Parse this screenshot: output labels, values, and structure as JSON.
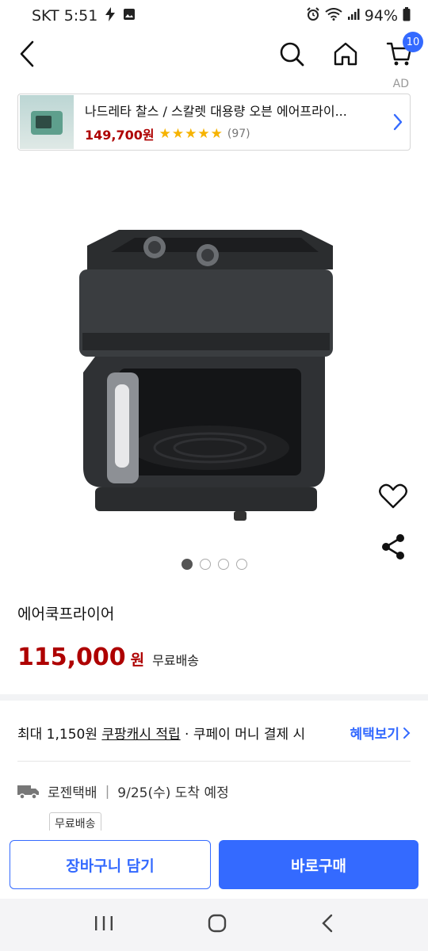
{
  "status": {
    "carrier_time": "SKT 5:51",
    "battery": "94%"
  },
  "nav": {
    "cart_count": "10"
  },
  "ad": {
    "label": "AD",
    "title": "나드레타 찰스 / 스칼렛 대용량 오븐 에어프라이...",
    "price": "149,700원",
    "review_count": "(97)",
    "rating_stars": 5
  },
  "product": {
    "name": "에어쿡프라이어",
    "price": "115,000",
    "price_unit": "원",
    "shipping": "무료배송",
    "image_count": 4,
    "active_image": 1
  },
  "benefit": {
    "text_prefix": "최대 1,150원 ",
    "text_underlined": "쿠팡캐시 적립",
    "text_suffix": " · 쿠페이 머니 결제 시",
    "link": "혜택보기"
  },
  "delivery": {
    "carrier": "로젠택배",
    "arrival": "9/25(수) 도착 예정",
    "badge": "무료배송"
  },
  "actions": {
    "cart_button": "장바구니 담기",
    "buy_button": "바로구매"
  },
  "colors": {
    "accent": "#346aff",
    "price_red": "#ae0000",
    "star": "#f6b300"
  }
}
